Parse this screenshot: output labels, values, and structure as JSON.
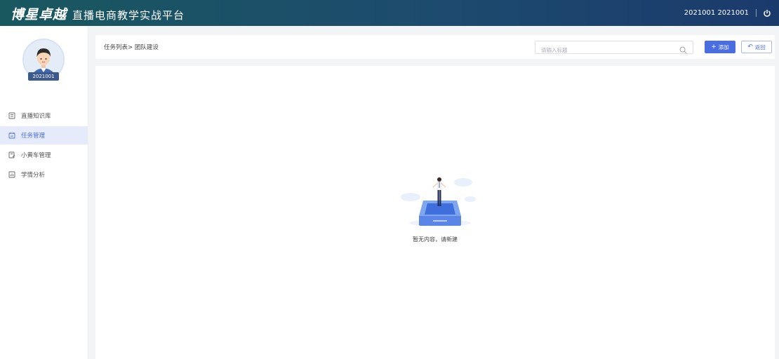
{
  "header": {
    "logo": "博星卓越",
    "platform_title": "直播电商教学实战平台",
    "user_text": "2021001 2021001"
  },
  "sidebar": {
    "avatar_label": "2021001",
    "items": [
      {
        "label": "直播知识库",
        "icon": "book-icon",
        "active": false
      },
      {
        "label": "任务管理",
        "icon": "task-icon",
        "active": true
      },
      {
        "label": "小黄车管理",
        "icon": "cart-edit-icon",
        "active": false
      },
      {
        "label": "学情分析",
        "icon": "chart-doc-icon",
        "active": false
      }
    ]
  },
  "toolbar": {
    "breadcrumb": "任务列表> 团队建设",
    "search_placeholder": "请输入标题",
    "add_label": "添加",
    "back_label": "返回"
  },
  "content": {
    "empty_text": "暂无内容，请新建"
  },
  "colors": {
    "accent": "#4a6ee0",
    "topbar_start": "#19585f",
    "topbar_end": "#1b3a6c",
    "active_bg": "#e6ebfb"
  }
}
